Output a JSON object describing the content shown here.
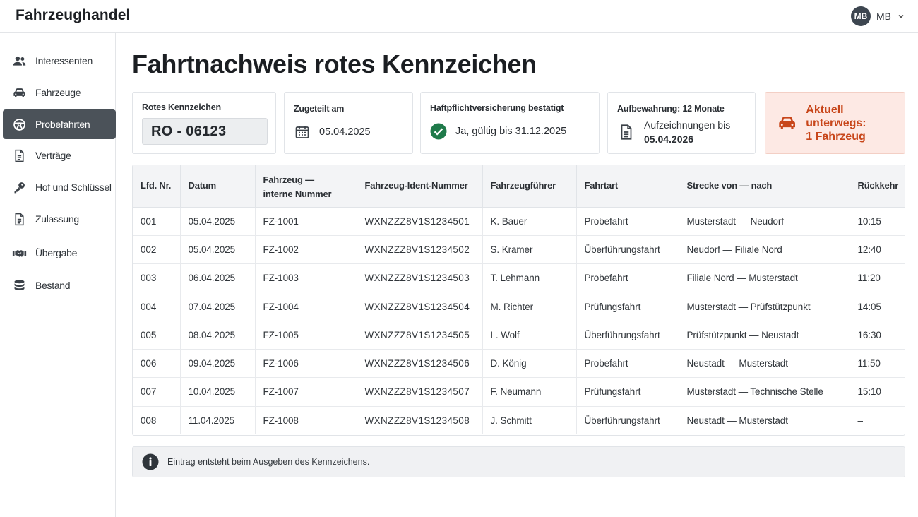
{
  "app": {
    "title": "Fahrzeughandel"
  },
  "user": {
    "initials": "MB",
    "name": "MB"
  },
  "sidebar": {
    "items": [
      {
        "label": "Interessenten",
        "icon": "users-icon"
      },
      {
        "label": "Fahrzeuge",
        "icon": "car-icon"
      },
      {
        "label": "Probefahrten",
        "icon": "steering-wheel-icon",
        "active": true
      },
      {
        "label": "Verträge",
        "icon": "document-icon"
      },
      {
        "label": "Hof und Schlüssel",
        "icon": "key-icon"
      },
      {
        "label": "Zulassung",
        "icon": "document-icon"
      },
      {
        "label": "Übergabe",
        "icon": "handshake-icon"
      },
      {
        "label": "Bestand",
        "icon": "database-icon"
      }
    ]
  },
  "page": {
    "title": "Fahrtnachweis rotes Kennzeichen"
  },
  "cards": {
    "plate": {
      "label": "Rotes Kennzeichen",
      "value": "RO - 06123"
    },
    "assigned": {
      "label": "Zugeteilt am",
      "value": "05.04.2025"
    },
    "insurance": {
      "label": "Haftpflichtversicherung bestätigt",
      "value": "Ja, gültig bis 31.12.2025"
    },
    "retention": {
      "label": "Aufbewahrung: 12 Monate",
      "line1": "Aufzeichnungen bis",
      "line2": "05.04.2026"
    },
    "status": {
      "line1": "Aktuell unterwegs:",
      "line2": "1 Fahrzeug"
    }
  },
  "table": {
    "headers": [
      "Lfd. Nr.",
      "Datum",
      "Fahrzeug —\ninterne Nummer",
      "Fahrzeug-Ident-Nummer",
      "Fahrzeugführer",
      "Fahrtart",
      "Strecke von — nach",
      "Rückkehr"
    ],
    "rows": [
      [
        "001",
        "05.04.2025",
        "FZ-1001",
        "WXNZZZ8V1S1234501",
        "K. Bauer",
        "Probefahrt",
        "Musterstadt — Neudorf",
        "10:15"
      ],
      [
        "002",
        "05.04.2025",
        "FZ-1002",
        "WXNZZZ8V1S1234502",
        "S. Kramer",
        "Überführungsfahrt",
        "Neudorf — Filiale Nord",
        "12:40"
      ],
      [
        "003",
        "06.04.2025",
        "FZ-1003",
        "WXNZZZ8V1S1234503",
        "T. Lehmann",
        "Probefahrt",
        "Filiale Nord — Musterstadt",
        "11:20"
      ],
      [
        "004",
        "07.04.2025",
        "FZ-1004",
        "WXNZZZ8V1S1234504",
        "M. Richter",
        "Prüfungsfahrt",
        "Musterstadt — Prüfstützpunkt",
        "14:05"
      ],
      [
        "005",
        "08.04.2025",
        "FZ-1005",
        "WXNZZZ8V1S1234505",
        "L. Wolf",
        "Überführungsfahrt",
        "Prüfstützpunkt — Neustadt",
        "16:30"
      ],
      [
        "006",
        "09.04.2025",
        "FZ-1006",
        "WXNZZZ8V1S1234506",
        "D. König",
        "Probefahrt",
        "Neustadt — Musterstadt",
        "11:50"
      ],
      [
        "007",
        "10.04.2025",
        "FZ-1007",
        "WXNZZZ8V1S1234507",
        "F. Neumann",
        "Prüfungsfahrt",
        "Musterstadt — Technische Stelle",
        "15:10"
      ],
      [
        "008",
        "11.04.2025",
        "FZ-1008",
        "WXNZZZ8V1S1234508",
        "J. Schmitt",
        "Überführungsfahrt",
        "Neustadt — Musterstadt",
        "–"
      ]
    ]
  },
  "info": {
    "text": "Eintrag entsteht beim Ausgeben des Kennzeichens."
  },
  "colors": {
    "accent": "#c8461a",
    "success": "#1f7a4a",
    "active_nav": "#4b5259"
  }
}
